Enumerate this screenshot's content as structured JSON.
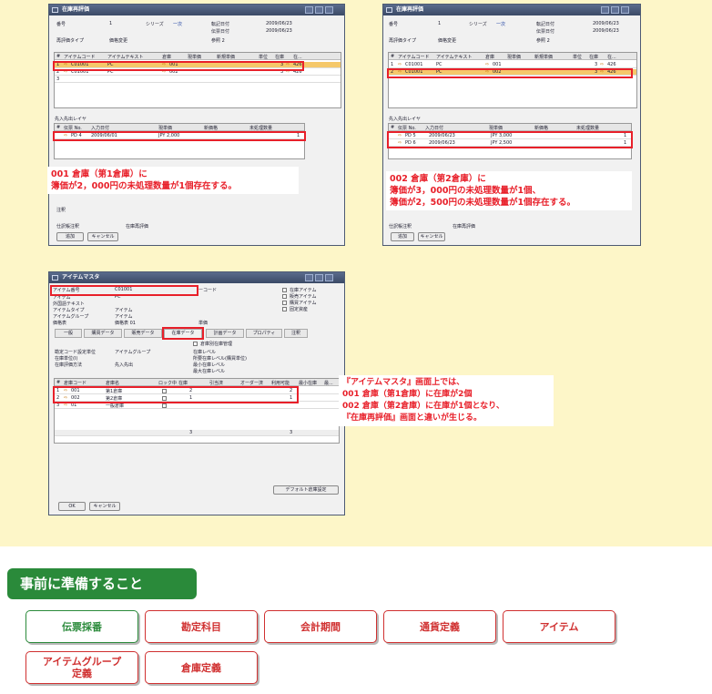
{
  "win1": {
    "title": "在庫再評価",
    "labels": {
      "number": "番号",
      "series": "シリーズ",
      "posting_date": "転記日付",
      "doc_date": "伝票日付",
      "reval_type": "再評価タイプ",
      "ref": "参照 2"
    },
    "values": {
      "number": "1",
      "series": "一次",
      "posting_date": "2009/06/23",
      "doc_date": "2009/06/23",
      "reval_type": "価格変更"
    },
    "grid_headers": [
      "#",
      "アイテムコード",
      "アイテムテキスト",
      "倉庫",
      "現単価",
      "新規単価",
      "単位",
      "在庫",
      "在..."
    ],
    "rows": [
      {
        "num": "1",
        "code": "C01001",
        "text": "PC",
        "wh": "001",
        "stock": "3",
        "extra": "426"
      },
      {
        "num": "2",
        "code": "C01001",
        "text": "PC",
        "wh": "002",
        "stock": "3",
        "extra": "426"
      },
      {
        "num": "3",
        "code": "",
        "text": "",
        "wh": "",
        "stock": "",
        "extra": ""
      }
    ],
    "fifo_label": "先入先出レイヤ",
    "fifo_headers": [
      "#",
      "伝票 No.",
      "入力日付",
      "現単価",
      "新価格",
      "未処理数量"
    ],
    "fifo_rows": [
      {
        "doc": "PD 4",
        "date": "2009/06/01",
        "price": "JPY 2,000",
        "qty": "1"
      }
    ],
    "remarks_label": "注釈",
    "journal_label": "仕訳帳注釈",
    "journal_value": "在庫再評価",
    "add_button": "追加",
    "cancel_button": "キャンセル"
  },
  "note1": {
    "line1": "001 倉庫（第1倉庫）に",
    "line2": "簿価が2，000円の未処理数量が1個存在する。"
  },
  "win2": {
    "title": "在庫再評価",
    "values": {
      "number": "1",
      "series": "一次",
      "posting_date": "2009/06/23",
      "doc_date": "2009/06/23",
      "reval_type": "価格変更"
    },
    "fifo_rows": [
      {
        "doc": "PD 5",
        "date": "2009/06/23",
        "price": "JPY 3,000",
        "qty": "1"
      },
      {
        "doc": "PD 6",
        "date": "2009/06/23",
        "price": "JPY 2,500",
        "qty": "1"
      }
    ],
    "journal_value": "在庫再評価",
    "add_button": "追加",
    "cancel_button": "キャンセル"
  },
  "note2": {
    "line1": "002 倉庫（第2倉庫）に",
    "line2": "簿価が3，000円の未処理数量が1個、",
    "line3": "簿価が2，500円の未処理数量が1個存在する。"
  },
  "win3": {
    "title": "アイテムマスタ",
    "labels": {
      "item_no": "アイテム番号",
      "desc": "アイテム",
      "foreign": "外国語テキスト",
      "item_type": "アイテムタイプ",
      "item_group": "アイテムグループ",
      "price_list": "価格表",
      "barcode": "ーコード",
      "unit_price": "単価"
    },
    "values": {
      "item_no": "C01001",
      "desc": "PC",
      "item_type": "アイテム",
      "item_group": "アイテム",
      "price_list": "価格表 01"
    },
    "checks": [
      "在庫アイテム",
      "販売アイテム",
      "購買アイテム",
      "固定資産"
    ],
    "tabs": [
      "一般",
      "購買データ",
      "販売データ",
      "在庫データ",
      "計画データ",
      "プロパティ",
      "注釈"
    ],
    "inv_labels": {
      "by_wh": "倉庫別在庫管理",
      "uom": "勘定コード設定単位",
      "inv_unit": "在庫単位(I)",
      "method": "在庫評価方法",
      "level": "在庫レベル",
      "min": "所要在庫レベル(購買単位)",
      "min2": "最小在庫レベル",
      "max": "最大在庫レベル"
    },
    "inv_values": {
      "uom": "アイテムグループ",
      "method": "先入先出"
    },
    "wh_headers": [
      "#",
      "倉庫コード",
      "倉庫名",
      "ロック中",
      "在庫",
      "引当済",
      "オーダー済",
      "利用可能",
      "最小在庫",
      "最..."
    ],
    "wh_rows": [
      {
        "num": "1",
        "code": "001",
        "name": "第1倉庫",
        "stock": "2",
        "avail": "2"
      },
      {
        "num": "2",
        "code": "002",
        "name": "第2倉庫",
        "stock": "1",
        "avail": "1"
      },
      {
        "num": "3",
        "code": "01",
        "name": "一般倉庫",
        "stock": "",
        "avail": ""
      }
    ],
    "total_stock": "3",
    "total_avail": "3",
    "default_wh_button": "デフォルト倉庫設定",
    "ok_button": "OK",
    "cancel_button": "キャンセル"
  },
  "note3": {
    "line1": "『アイテムマスタ』画面上では、",
    "line2": "001 倉庫（第1倉庫）に在庫が2個",
    "line3": "002 倉庫（第2倉庫）に在庫が1個となり、",
    "line4": "『在庫再評価』画面と違いが生じる。"
  },
  "prep": {
    "title": "事前に準備すること",
    "buttons": [
      "伝票採番",
      "勘定科目",
      "会計期間",
      "通貨定義",
      "アイテム"
    ],
    "buttons2_a1": "アイテムグループ",
    "buttons2_a2": "定義",
    "buttons2_b": "倉庫定義"
  },
  "colors": {
    "panel": "#fdf6c8",
    "accent": "#e8202a",
    "green": "#2a8a3a"
  }
}
